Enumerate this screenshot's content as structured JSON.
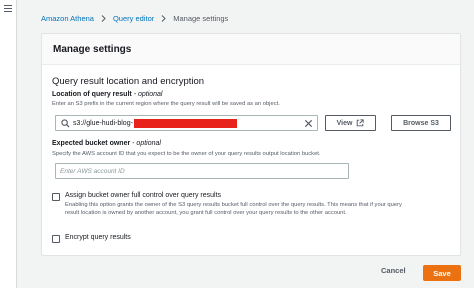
{
  "breadcrumb": {
    "items": [
      "Amazon Athena",
      "Query editor"
    ],
    "current": "Manage settings"
  },
  "panel": {
    "title": "Manage settings",
    "section_title": "Query result location and encryption",
    "location": {
      "label": "Location of query result",
      "optional": "- optional",
      "description": "Enter an S3 prefix in the current region where the query result will be saved as an object.",
      "value": "s3://glue-hudi-blog-",
      "redacted": true,
      "view_label": "View",
      "browse_label": "Browse S3"
    },
    "owner": {
      "label": "Expected bucket owner",
      "optional": "- optional",
      "description": "Specify the AWS account ID that you expect to be the owner of your query results output location bucket.",
      "placeholder": "Enter AWS account ID"
    },
    "assign_owner": {
      "label": "Assign bucket owner full control over query results",
      "description_line1": "Enabling this option grants the owner of the S3 query results bucket full control over the query results. This means that if your query",
      "description_line2": "result location is owned by another account, you grant full control over your query results to the other account.",
      "checked": false
    },
    "encrypt": {
      "label": "Encrypt query results",
      "checked": false
    }
  },
  "footer": {
    "cancel_label": "Cancel",
    "save_label": "Save"
  },
  "colors": {
    "link": "#0073bb",
    "primary": "#ec7211",
    "redaction": "#e8231c"
  }
}
